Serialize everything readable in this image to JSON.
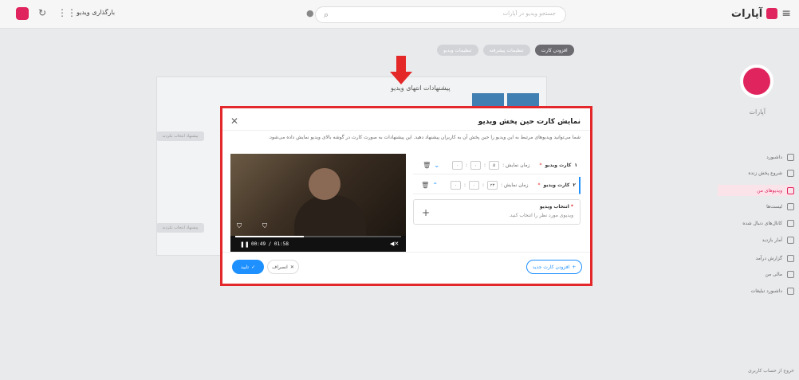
{
  "topbar": {
    "brand_name": "آپارات",
    "search_placeholder": "جستجو ویدیو در آپارات",
    "upload_label": "بارگذاری ویدیو"
  },
  "sidebar": {
    "channel_name": "آپارات",
    "items": [
      {
        "label": "داشبورد",
        "icon": "dashboard-icon"
      },
      {
        "label": "شروع پخش زنده",
        "icon": "live-icon"
      },
      {
        "label": "ویدیوهای من",
        "icon": "videos-icon",
        "active": true
      },
      {
        "label": "لیست‌ها",
        "icon": "list-icon"
      },
      {
        "label": "کانال‌های دنبال شده",
        "icon": "channels-icon"
      },
      {
        "label": "آمار بازدید",
        "icon": "stats-icon"
      },
      {
        "label": "گزارش درآمد",
        "icon": "income-icon"
      },
      {
        "label": "مالی من",
        "icon": "wallet-icon"
      },
      {
        "label": "داشبورد تبلیغات",
        "icon": "ads-icon"
      }
    ],
    "footer": "خروج از حساب کاربری"
  },
  "chips": [
    "تنظیمات ویدیو",
    "تنظیمات پیشرفته",
    "افزودن کارت"
  ],
  "background": {
    "section_title": "پیشنهادات انتهای ویدیو",
    "button_1": "پیشنهاد انتخاب نکردید",
    "button_2": "پیشنهاد انتخاب نکردید"
  },
  "modal": {
    "title": "نمایش کارت حین پخش ویدیو",
    "description": "شما می‌توانید ویدیوهای مرتبط به این ویدیو را حین پخش آن به کاربران پیشنهاد دهید. این پیشنهادات به صورت کارت در گوشه بالای ویدیو نمایش داده می‌شود.",
    "cards": [
      {
        "num": "۱",
        "label": "کارت ویدیو",
        "time_label": "زمان نمایش :",
        "sec": "۵",
        "min": "۰",
        "hr": "۰"
      },
      {
        "num": "۲",
        "label": "کارت ویدیو",
        "time_label": "زمان نمایش :",
        "sec": "۲۳",
        "min": "۰",
        "hr": "۰"
      }
    ],
    "select": {
      "title": "انتخاب ویدیو",
      "hint": "ویدیوی مورد نظر را انتخاب کنید."
    },
    "add_button": "افزودن کارت جدید",
    "confirm_button": "تایید",
    "cancel_button": "انصراف"
  },
  "video": {
    "time": "00:49 / 01:58",
    "progress": 0.415
  }
}
